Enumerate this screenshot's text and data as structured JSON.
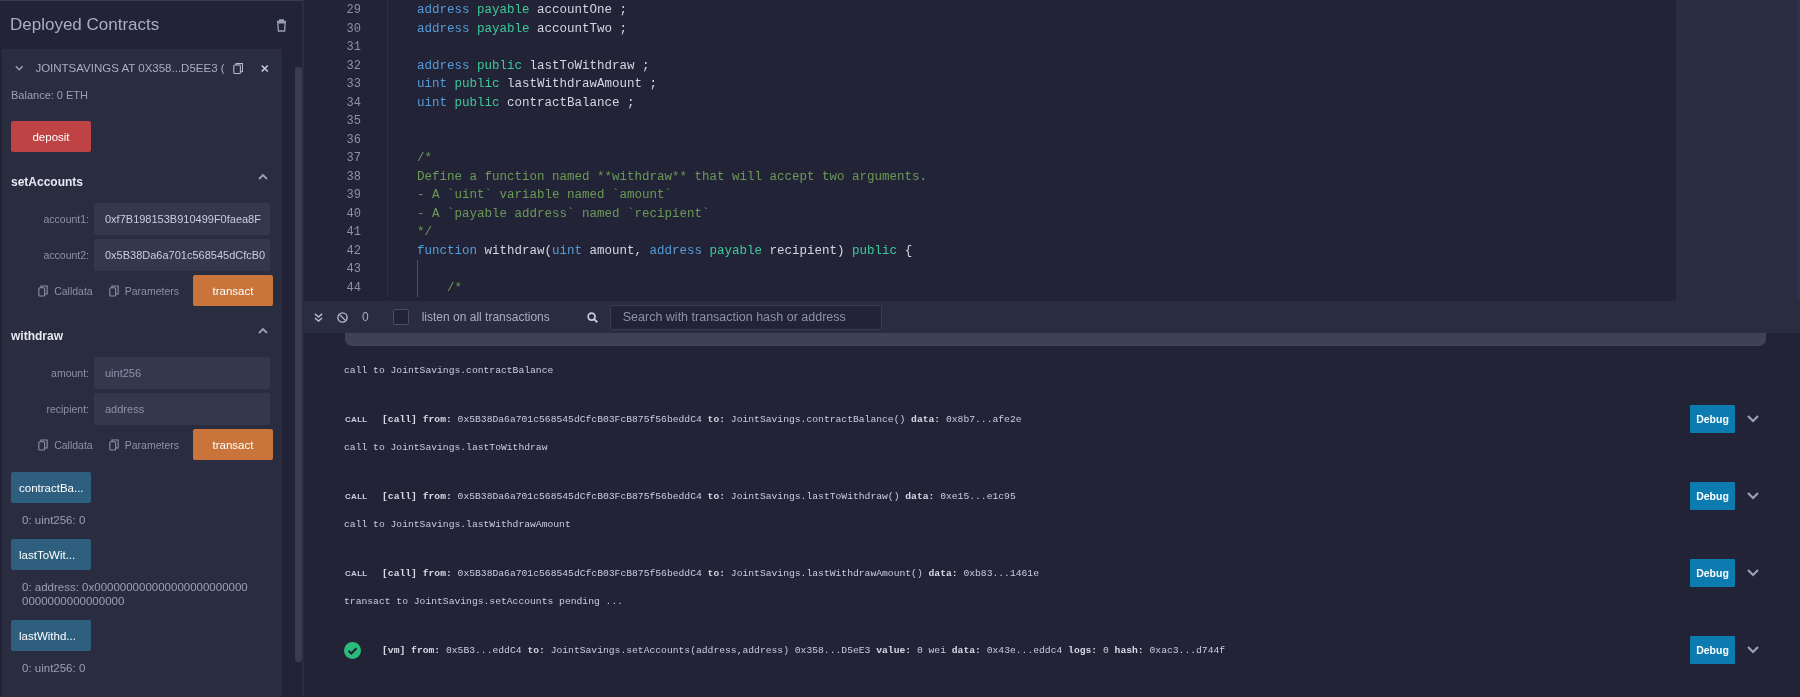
{
  "sidebar": {
    "title": "Deployed Contracts",
    "contract": {
      "title": "JOINTSAVINGS AT 0X358...D5EE3 (",
      "expanded": true,
      "balance": "Balance: 0 ETH",
      "functions": [
        {
          "kind": "payable",
          "label": "deposit"
        },
        {
          "kind": "form",
          "name": "setAccounts",
          "expanded": true,
          "inputs": [
            {
              "label": "account1:",
              "value": "0xf7B198153B910499F0faea8F"
            },
            {
              "label": "account2:",
              "value": "0x5B38Da6a701c568545dCfcB0"
            }
          ],
          "actions": [
            "Calldata",
            "Parameters"
          ],
          "submit": "transact"
        },
        {
          "kind": "form",
          "name": "withdraw",
          "expanded": true,
          "inputs": [
            {
              "label": "amount:",
              "placeholder": "uint256"
            },
            {
              "label": "recipient:",
              "placeholder": "address"
            }
          ],
          "actions": [
            "Calldata",
            "Parameters"
          ],
          "submit": "transact"
        },
        {
          "kind": "call",
          "label": "contractBa...",
          "result": "0: uint256: 0"
        },
        {
          "kind": "call",
          "label": "lastToWit...",
          "result": "0:  address: 0x0000000000000000000000000000000000000000"
        },
        {
          "kind": "call",
          "label": "lastWithd...",
          "result": "0: uint256: 0"
        }
      ]
    }
  },
  "editor": {
    "lines": [
      {
        "number": "29",
        "tokens": [
          {
            "kind": "type",
            "text": "address"
          },
          {
            "kind": "mod",
            "text": " payable"
          },
          {
            "kind": "plain",
            "text": " accountOne ;"
          }
        ]
      },
      {
        "number": "30",
        "tokens": [
          {
            "kind": "type",
            "text": "address"
          },
          {
            "kind": "mod",
            "text": " payable"
          },
          {
            "kind": "plain",
            "text": " accountTwo ;"
          }
        ]
      },
      {
        "number": "31"
      },
      {
        "number": "32",
        "tokens": [
          {
            "kind": "type",
            "text": "address"
          },
          {
            "kind": "mod",
            "text": " public"
          },
          {
            "kind": "plain",
            "text": " lastToWithdraw ;"
          }
        ]
      },
      {
        "number": "33",
        "tokens": [
          {
            "kind": "type",
            "text": "uint"
          },
          {
            "kind": "mod",
            "text": " public"
          },
          {
            "kind": "plain",
            "text": " lastWithdrawAmount ;"
          }
        ]
      },
      {
        "number": "34",
        "tokens": [
          {
            "kind": "type",
            "text": "uint"
          },
          {
            "kind": "mod",
            "text": " public"
          },
          {
            "kind": "plain",
            "text": " contractBalance ;"
          }
        ]
      },
      {
        "number": "35"
      },
      {
        "number": "36"
      },
      {
        "number": "37",
        "tokens": [
          {
            "kind": "comment",
            "text": "/*"
          }
        ]
      },
      {
        "number": "38",
        "tokens": [
          {
            "kind": "comment",
            "text": "Define a function named **withdraw** that will accept two arguments."
          }
        ]
      },
      {
        "number": "39",
        "tokens": [
          {
            "kind": "comment",
            "text": "- A `uint` variable named `amount`"
          }
        ]
      },
      {
        "number": "40",
        "tokens": [
          {
            "kind": "comment",
            "text": "- A `payable address` named `recipient`"
          }
        ]
      },
      {
        "number": "41",
        "tokens": [
          {
            "kind": "comment",
            "text": "*/"
          }
        ]
      },
      {
        "number": "42",
        "tokens": [
          {
            "kind": "type",
            "text": "function"
          },
          {
            "kind": "plain",
            "text": " withdraw("
          },
          {
            "kind": "type",
            "text": "uint"
          },
          {
            "kind": "plain",
            "text": " amount, "
          },
          {
            "kind": "type",
            "text": "address"
          },
          {
            "kind": "mod",
            "text": " payable"
          },
          {
            "kind": "plain",
            "text": " recipient) "
          },
          {
            "kind": "mod",
            "text": "public"
          },
          {
            "kind": "plain",
            "text": " {"
          }
        ]
      },
      {
        "number": "43",
        "guide": true
      },
      {
        "number": "44",
        "guide": true,
        "tokens": [
          {
            "kind": "comment",
            "text": "    /*"
          }
        ]
      }
    ]
  },
  "terminal": {
    "count": "0",
    "listen": {
      "label": "listen on all transactions",
      "checked": false
    },
    "search": {
      "placeholder": "Search with transaction hash or address"
    },
    "entries": [
      {
        "log": "call to JointSavings.contractBalance",
        "kind": "call",
        "badge": "CALL",
        "detail": "**[call]**  **from:** 0x5B38Da6a701c568545dCfcB03FcB875f56beddC4 **to:** JointSavings.contractBalance() **data:** 0x8b7...afe2e",
        "debug": "Debug"
      },
      {
        "log": "call to JointSavings.lastToWithdraw",
        "kind": "call",
        "badge": "CALL",
        "detail": "**[call]**  **from:** 0x5B38Da6a701c568545dCfcB03FcB875f56beddC4 **to:** JointSavings.lastToWithdraw() **data:** 0xe15...e1c95",
        "debug": "Debug"
      },
      {
        "log": "call to JointSavings.lastWithdrawAmount",
        "kind": "call",
        "badge": "CALL",
        "detail": "**[call]**  **from:** 0x5B38Da6a701c568545dCfcB03FcB875f56beddC4 **to:** JointSavings.lastWithdrawAmount() **data:** 0xb83...1461e",
        "debug": "Debug"
      },
      {
        "log": "transact to JointSavings.setAccounts pending ...",
        "kind": "vm",
        "detail": "**[vm]**  **from:** 0x5B3...eddC4 **to:** JointSavings.setAccounts(address,address) 0x358...D5eE3 **value:** 0 wei **data:** 0x43e...eddc4 **logs:** 0 **hash:** 0xac3...d744f",
        "debug": "Debug"
      }
    ]
  }
}
